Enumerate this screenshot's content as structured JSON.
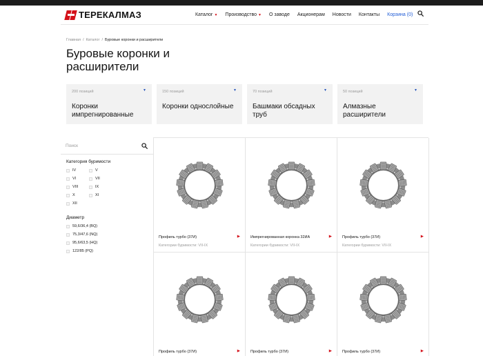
{
  "colors": {
    "accent": "#d4111a",
    "link": "#1f5bd6",
    "card_bg": "#f2f2f2"
  },
  "header": {
    "brand": "ТЕРЕКАЛМАЗ",
    "nav": [
      {
        "label": "Каталог",
        "has_dropdown": true
      },
      {
        "label": "Производство",
        "has_dropdown": true
      },
      {
        "label": "О заводе",
        "has_dropdown": false
      },
      {
        "label": "Акционерам",
        "has_dropdown": false
      },
      {
        "label": "Новости",
        "has_dropdown": false
      },
      {
        "label": "Контакты",
        "has_dropdown": false
      }
    ],
    "cart_label": "Корзина (0)",
    "search_icon": "search-icon"
  },
  "breadcrumb": [
    "Главная",
    "/",
    "Каталог",
    "/",
    "Буровые коронки и расширители"
  ],
  "page_title": "Буровые коронки и расширители",
  "categories": [
    {
      "count": "200 позиций",
      "name": "Коронки импрегнированные"
    },
    {
      "count": "150 позиций",
      "name": "Коронки однослойные"
    },
    {
      "count": "70 позиций",
      "name": "Башмаки обсадных труб"
    },
    {
      "count": "50 позиций",
      "name": "Алмазные расширители"
    }
  ],
  "sidebar": {
    "search_placeholder": "Поиск",
    "drillability_title": "Категория буримости",
    "drillability": [
      "IV",
      "V",
      "VI",
      "VII",
      "VIII",
      "IX",
      "X",
      "XI",
      "XII"
    ],
    "diameter_title": "Диаметр",
    "diameters": [
      "59,6/36,4 (BQ)",
      "75,3/47,6 (NQ)",
      "95,6/63,5 (HQ)",
      "122/85 (PQ)"
    ]
  },
  "products": [
    {
      "name": "Профиль турбо (37И)",
      "category": "Категории буримости: VII-IX"
    },
    {
      "name": "Импрегнированная коронка 32ИА",
      "category": "Категории буримости: VII-IX"
    },
    {
      "name": "Профиль турбо (37И)",
      "category": "Категории буримости: VII-IX"
    },
    {
      "name": "Профиль турбо (37И)",
      "category": ""
    },
    {
      "name": "Профиль турбо (37И)",
      "category": ""
    },
    {
      "name": "Профиль турбо (37И)",
      "category": ""
    }
  ]
}
